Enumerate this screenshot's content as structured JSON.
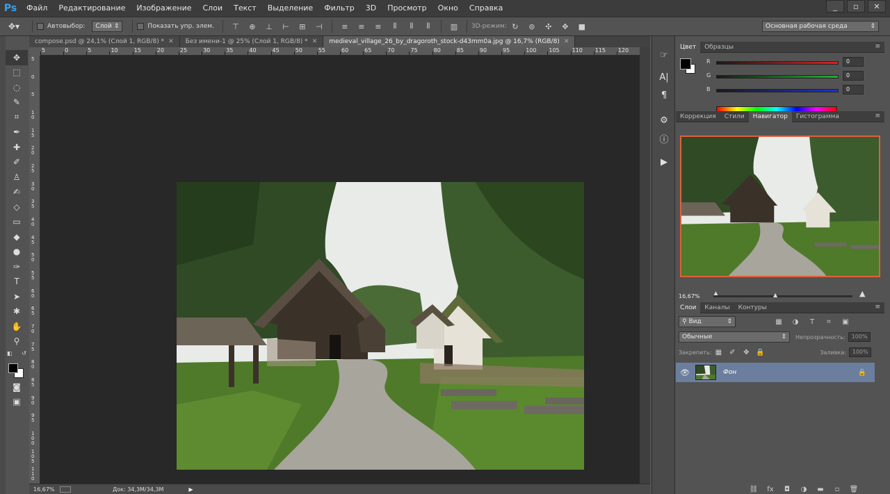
{
  "app": {
    "logo": "Ps"
  },
  "menu": [
    "Файл",
    "Редактирование",
    "Изображение",
    "Слои",
    "Текст",
    "Выделение",
    "Фильтр",
    "3D",
    "Просмотр",
    "Окно",
    "Справка"
  ],
  "window_controls": {
    "minimize": "_",
    "restore": "▫",
    "close": "✕"
  },
  "options": {
    "autoselect_label": "Автовыбор:",
    "autoselect_value": "Слой",
    "show_controls_label": "Показать упр. элем.",
    "mode3d_label": "3D-режим:",
    "workspace": "Основная рабочая среда"
  },
  "tabs": [
    {
      "label": "compose.psd @ 24,1% (Слой 1, RGB/8) *",
      "close": "✕"
    },
    {
      "label": "Без имени-1 @ 25% (Слой 1, RGB/8) *",
      "close": "✕"
    },
    {
      "label": "medieval_village_26_by_dragoroth_stock-d43mm0a.jpg @ 16,7% (RGB/8)",
      "close": "✕"
    }
  ],
  "ruler_top": [
    "5",
    "0",
    "5",
    "10",
    "15",
    "20",
    "25",
    "30",
    "35",
    "40",
    "45",
    "50",
    "55",
    "60",
    "65",
    "70",
    "75",
    "80",
    "85",
    "90",
    "95",
    "100",
    "105",
    "110",
    "115",
    "120"
  ],
  "ruler_left": [
    "5",
    "0",
    "5",
    "1 0",
    "1 5",
    "2 0",
    "2 5",
    "3 0",
    "3 5",
    "4 0",
    "4 5",
    "5 0",
    "5 5",
    "6 0",
    "6 5",
    "7 0",
    "7 5",
    "8 0",
    "8 5",
    "9 0",
    "9 5",
    "1 0 0",
    "1 0 5",
    "1 1 0"
  ],
  "status": {
    "zoom": "16,67%",
    "doc": "Док: 34,3M/34,3M"
  },
  "color_panel": {
    "tabs": [
      "Цвет",
      "Образцы"
    ],
    "r_label": "R",
    "g_label": "G",
    "b_label": "B",
    "r_value": "0",
    "g_value": "0",
    "b_value": "0",
    "colors": {
      "r_track": "#e02020",
      "g_track": "#20b030",
      "b_track": "#2030d0"
    }
  },
  "nav_panel": {
    "tabs": [
      "Коррекция",
      "Стили",
      "Навигатор",
      "Гистограмма"
    ],
    "zoom": "16,67%",
    "view_box_color": "#e0603a"
  },
  "layers_panel": {
    "tabs": [
      "Слои",
      "Каналы",
      "Контуры"
    ],
    "filter_label": "Вид",
    "blend_mode": "Обычные",
    "opacity_label": "Непрозрачность:",
    "opacity_value": "100%",
    "lock_label": "Закрепить:",
    "fill_label": "Заливка:",
    "fill_value": "100%",
    "layer_name": "Фон",
    "selected_color": "#6b7e9e"
  }
}
